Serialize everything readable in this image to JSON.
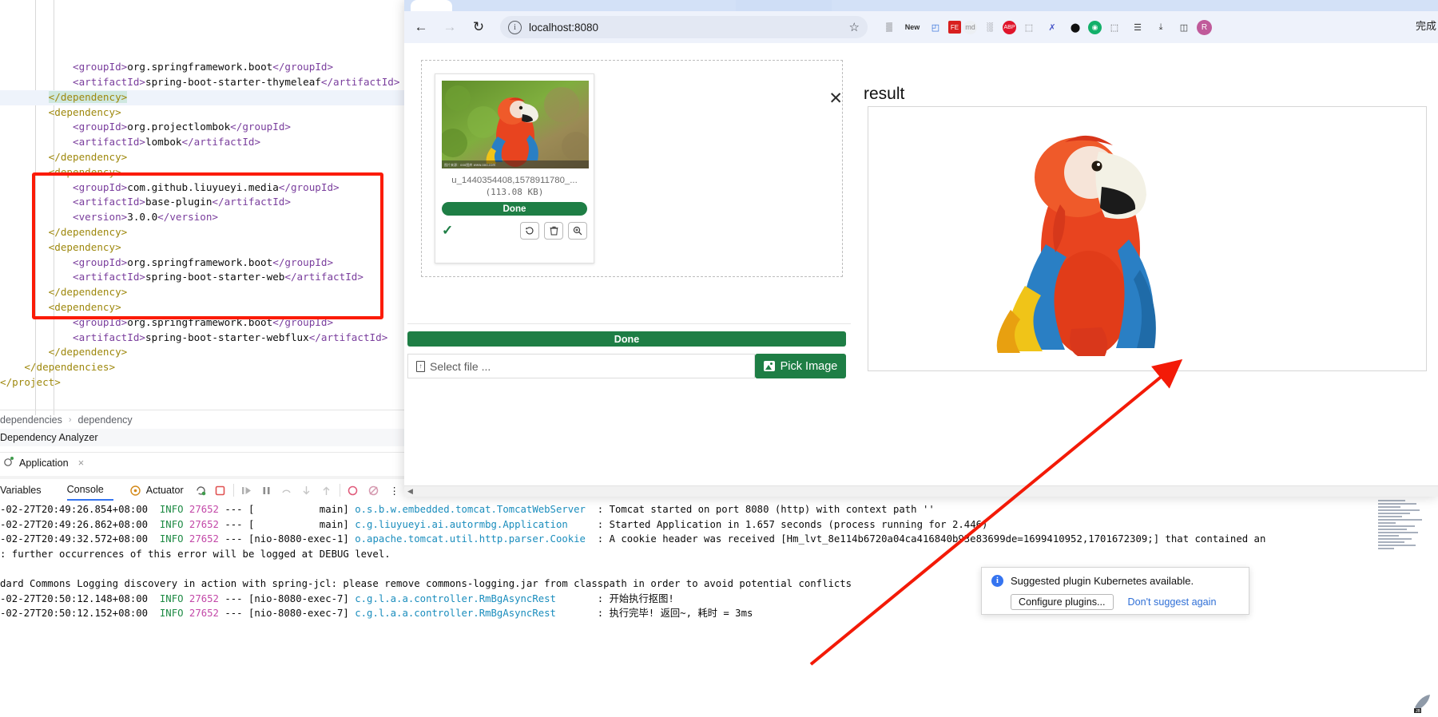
{
  "editor": {
    "code_lines": [
      {
        "indent": 3,
        "parts": [
          {
            "t": "<",
            "c": "tag"
          },
          {
            "t": "groupId",
            "c": "tag"
          },
          {
            "t": ">",
            "c": "tag"
          },
          {
            "t": "org.springframework.boot",
            "c": "txt"
          },
          {
            "t": "</groupId>",
            "c": "tag"
          }
        ]
      },
      {
        "indent": 3,
        "parts": [
          {
            "t": "<artifactId>",
            "c": "tag"
          },
          {
            "t": "spring-boot-starter-thymeleaf",
            "c": "txt"
          },
          {
            "t": "</artifactId>",
            "c": "tag"
          }
        ]
      },
      {
        "indent": 2,
        "highlight": true,
        "parts": [
          {
            "t": "</dependency>",
            "c": "tagy sel"
          }
        ]
      },
      {
        "indent": 2,
        "parts": [
          {
            "t": "<dependency>",
            "c": "tagy"
          }
        ]
      },
      {
        "indent": 3,
        "parts": [
          {
            "t": "<groupId>",
            "c": "tag"
          },
          {
            "t": "org.projectlombok",
            "c": "txt"
          },
          {
            "t": "</groupId>",
            "c": "tag"
          }
        ]
      },
      {
        "indent": 3,
        "parts": [
          {
            "t": "<artifactId>",
            "c": "tag"
          },
          {
            "t": "lombok",
            "c": "txt"
          },
          {
            "t": "</artifactId>",
            "c": "tag"
          }
        ]
      },
      {
        "indent": 2,
        "parts": [
          {
            "t": "</dependency>",
            "c": "tagy"
          }
        ]
      },
      {
        "indent": 2,
        "parts": [
          {
            "t": "<dependency>",
            "c": "tagy"
          }
        ]
      },
      {
        "indent": 3,
        "parts": [
          {
            "t": "<groupId>",
            "c": "tag"
          },
          {
            "t": "com.github.liuyueyi.media",
            "c": "txt"
          },
          {
            "t": "</groupId>",
            "c": "tag"
          }
        ]
      },
      {
        "indent": 3,
        "parts": [
          {
            "t": "<artifactId>",
            "c": "tag"
          },
          {
            "t": "base-plugin",
            "c": "txt"
          },
          {
            "t": "</artifactId>",
            "c": "tag"
          }
        ]
      },
      {
        "indent": 3,
        "parts": [
          {
            "t": "<version>",
            "c": "tag"
          },
          {
            "t": "3.0.0",
            "c": "txt"
          },
          {
            "t": "</version>",
            "c": "tag"
          }
        ]
      },
      {
        "indent": 2,
        "parts": [
          {
            "t": "</dependency>",
            "c": "tagy"
          }
        ]
      },
      {
        "indent": 2,
        "parts": [
          {
            "t": "<dependency>",
            "c": "tagy"
          }
        ]
      },
      {
        "indent": 3,
        "parts": [
          {
            "t": "<groupId>",
            "c": "tag"
          },
          {
            "t": "org.springframework.boot",
            "c": "txt"
          },
          {
            "t": "</groupId>",
            "c": "tag"
          }
        ]
      },
      {
        "indent": 3,
        "parts": [
          {
            "t": "<artifactId>",
            "c": "tag"
          },
          {
            "t": "spring-boot-starter-web",
            "c": "txt"
          },
          {
            "t": "</artifactId>",
            "c": "tag"
          }
        ]
      },
      {
        "indent": 2,
        "parts": [
          {
            "t": "</dependency>",
            "c": "tagy"
          }
        ]
      },
      {
        "indent": 2,
        "parts": [
          {
            "t": "<dependency>",
            "c": "tagy"
          }
        ]
      },
      {
        "indent": 3,
        "parts": [
          {
            "t": "<groupId>",
            "c": "tag"
          },
          {
            "t": "org.springframework.boot",
            "c": "txt"
          },
          {
            "t": "</groupId>",
            "c": "tag"
          }
        ]
      },
      {
        "indent": 3,
        "parts": [
          {
            "t": "<artifactId>",
            "c": "tag"
          },
          {
            "t": "spring-boot-starter-webflux",
            "c": "txt"
          },
          {
            "t": "</artifactId>",
            "c": "tag"
          }
        ]
      },
      {
        "indent": 2,
        "parts": [
          {
            "t": "</dependency>",
            "c": "tagy"
          }
        ]
      },
      {
        "indent": 1,
        "parts": [
          {
            "t": "</dependencies>",
            "c": "tagy"
          }
        ]
      },
      {
        "indent": 0,
        "parts": [
          {
            "t": "</project>",
            "c": "tagy"
          }
        ]
      }
    ],
    "breadcrumb": {
      "item1": "dependencies",
      "separator": "›",
      "item2": "dependency"
    },
    "analyzer_label": "Dependency Analyzer"
  },
  "run_panel": {
    "config_tab": "Application",
    "close_label": "×",
    "tabs": [
      {
        "label": "Variables",
        "active": false
      },
      {
        "label": "Console",
        "active": true
      }
    ],
    "actuator_label": "Actuator",
    "toolbar_icons": [
      "rerun-icon",
      "stop-icon",
      "resume-icon",
      "pause-icon",
      "step-over-icon",
      "step-into-icon",
      "step-out-icon",
      "mute-breakpoints-icon",
      "view-breakpoints-icon",
      "more-options-icon"
    ]
  },
  "console": {
    "lines": [
      {
        "segments": [
          {
            "t": "-02-27T20:49:26.854+08:00 ",
            "c": "lg-plain"
          },
          {
            "t": " INFO ",
            "c": "lg-info"
          },
          {
            "t": "27652",
            "c": "lg-pid"
          },
          {
            "t": " --- [           main] ",
            "c": "lg-plain"
          },
          {
            "t": "o.s.b.w.embedded.tomcat.TomcatWebServer",
            "c": "lg-cls"
          },
          {
            "t": "  : Tomcat started on port 8080 (http) with context path ''",
            "c": "lg-plain"
          }
        ]
      },
      {
        "segments": [
          {
            "t": "-02-27T20:49:26.862+08:00 ",
            "c": "lg-plain"
          },
          {
            "t": " INFO ",
            "c": "lg-info"
          },
          {
            "t": "27652",
            "c": "lg-pid"
          },
          {
            "t": " --- [           main] ",
            "c": "lg-plain"
          },
          {
            "t": "c.g.liuyueyi.ai.autormbg.Application",
            "c": "lg-cls"
          },
          {
            "t": "     : Started Application in 1.657 seconds (process running for 2.446)",
            "c": "lg-plain"
          }
        ]
      },
      {
        "segments": [
          {
            "t": "-02-27T20:49:32.572+08:00 ",
            "c": "lg-plain"
          },
          {
            "t": " INFO ",
            "c": "lg-info"
          },
          {
            "t": "27652",
            "c": "lg-pid"
          },
          {
            "t": " --- [nio-8080-exec-1] ",
            "c": "lg-plain"
          },
          {
            "t": "o.apache.tomcat.util.http.parser.Cookie",
            "c": "lg-cls"
          },
          {
            "t": "  : A cookie header was received [Hm_lvt_8e114b6720a04ca416840b93e83699de=1699410952,1701672309;] that contained an",
            "c": "lg-plain"
          }
        ]
      },
      {
        "segments": [
          {
            "t": ": further occurrences of this error will be logged at DEBUG level.",
            "c": "lg-plain"
          }
        ]
      },
      {
        "segments": [
          {
            "t": "",
            "c": "lg-plain"
          }
        ]
      },
      {
        "segments": [
          {
            "t": "dard Commons Logging discovery in action with spring-jcl: please remove commons-logging.jar from classpath in order to avoid potential conflicts",
            "c": "lg-plain"
          }
        ]
      },
      {
        "segments": [
          {
            "t": "-02-27T20:50:12.148+08:00 ",
            "c": "lg-plain"
          },
          {
            "t": " INFO ",
            "c": "lg-info"
          },
          {
            "t": "27652",
            "c": "lg-pid"
          },
          {
            "t": " --- [nio-8080-exec-7] ",
            "c": "lg-plain"
          },
          {
            "t": "c.g.l.a.a.controller.RmBgAsyncRest",
            "c": "lg-cls"
          },
          {
            "t": "       : 开始执行抠图!",
            "c": "lg-plain"
          }
        ]
      },
      {
        "segments": [
          {
            "t": "-02-27T20:50:12.152+08:00 ",
            "c": "lg-plain"
          },
          {
            "t": " INFO ",
            "c": "lg-info"
          },
          {
            "t": "27652",
            "c": "lg-pid"
          },
          {
            "t": " --- [nio-8080-exec-7] ",
            "c": "lg-plain"
          },
          {
            "t": "c.g.l.a.a.controller.RmBgAsyncRest",
            "c": "lg-cls"
          },
          {
            "t": "       : 执行完毕! 返回~, 耗时 = 3ms",
            "c": "lg-plain"
          }
        ]
      }
    ]
  },
  "browser": {
    "nav": {
      "back": "←",
      "forward": "→",
      "reload": "↻"
    },
    "omnibox": {
      "info_glyph": "i",
      "url": "localhost:8080",
      "star": "☆"
    },
    "extensions": [
      {
        "name": "qrcode-extension",
        "glyph": "▒"
      },
      {
        "name": "new-clipper-extension",
        "glyph": "New"
      },
      {
        "name": "google-translate-extension",
        "glyph": "◰"
      },
      {
        "name": "feedly-extension",
        "glyph": "FE"
      },
      {
        "name": "markdown-extension",
        "glyph": "md"
      },
      {
        "name": "barcode-extension",
        "glyph": "░"
      },
      {
        "name": "adblock-plus-extension",
        "glyph": "ABP"
      },
      {
        "name": "screenshot-extension",
        "glyph": "⬚"
      },
      {
        "name": "x-extension",
        "glyph": "✗"
      },
      {
        "name": "opera-extension",
        "glyph": "⬤"
      },
      {
        "name": "recorder-extension",
        "glyph": "◉"
      },
      {
        "name": "puzzle-extensions-icon",
        "glyph": "⬚"
      },
      {
        "name": "reading-list-icon",
        "glyph": "☰"
      },
      {
        "name": "downloads-icon",
        "glyph": "⤓"
      },
      {
        "name": "side-panel-icon",
        "glyph": "◫"
      },
      {
        "name": "profile-avatar",
        "glyph": "R"
      }
    ],
    "right_label": "完成"
  },
  "uploader": {
    "close_glyph": "✕",
    "file": {
      "name": "u_1440354408,1578911780_...",
      "size": "(113.08 KB)",
      "status_label": "Done",
      "watermark": "图片来源：ooo图库 www.ooo.com",
      "check_glyph": "✓",
      "actions": [
        {
          "name": "rotate-icon",
          "glyph": "↻"
        },
        {
          "name": "delete-icon",
          "glyph": "🗑"
        },
        {
          "name": "zoom-icon",
          "glyph": "⌕"
        }
      ]
    },
    "done_button": "Done",
    "file_input_placeholder": "Select file ...",
    "pick_button": "Pick Image"
  },
  "result": {
    "title": "result"
  },
  "notification": {
    "info_glyph": "i",
    "message": "Suggested plugin Kubernetes available.",
    "configure_button": "Configure plugins...",
    "dismiss_link": "Don't suggest again"
  },
  "colors": {
    "green": "#1e7e45",
    "red_annotation": "#fb1b07",
    "blue_accent": "#3574f0",
    "browser_chrome": "#eef2fb"
  }
}
